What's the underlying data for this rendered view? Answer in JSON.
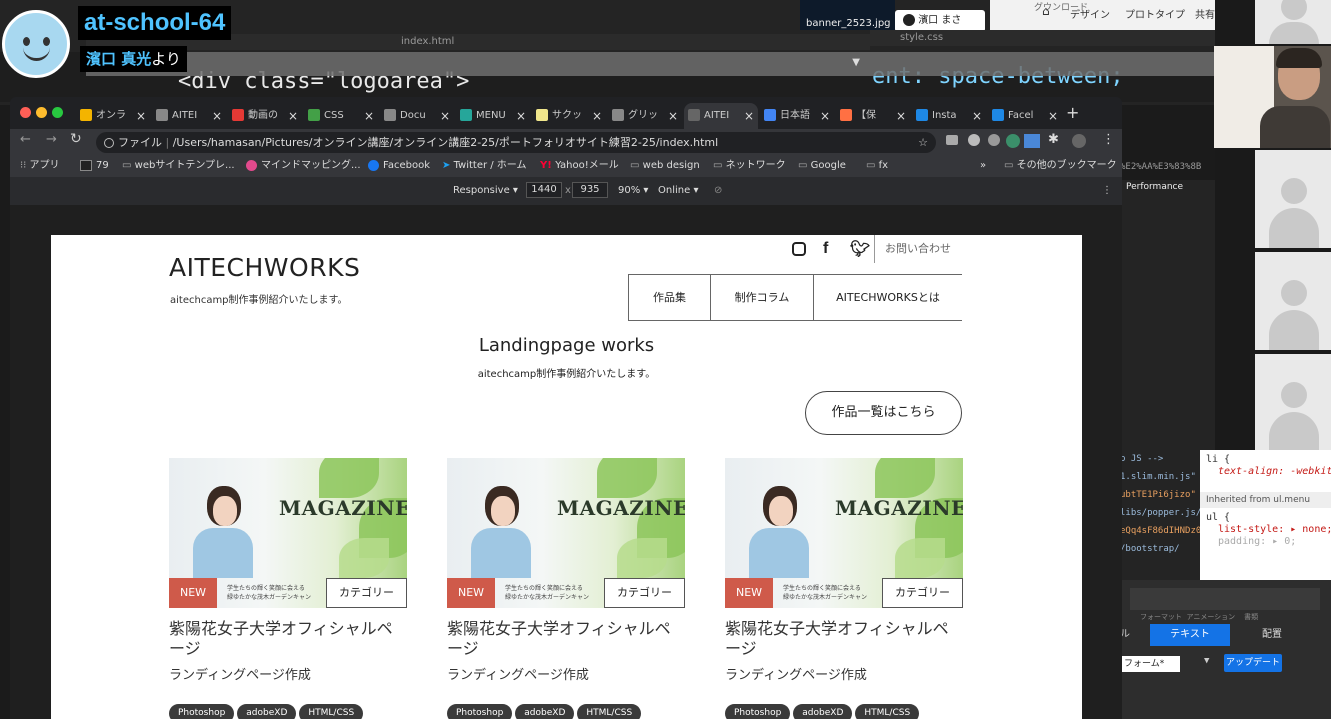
{
  "overlay": {
    "title": "at-school-64",
    "sub_name": "濱口 真光",
    "sub_suffix": "より"
  },
  "editor": {
    "tab_left": "index.html",
    "tab_right": "style.css",
    "code_left": "<div class=\"logoarea\">",
    "code_right": "ent: space-between;",
    "top_file": "banner_2523.jpg",
    "top_user": "濱口 まさ",
    "top_tab_design": "デザイン",
    "top_tab_proto": "プロトタイプ",
    "top_tab_share": "共有",
    "top_tab_download": "グウンロード"
  },
  "browser": {
    "tabs": [
      {
        "label": "オンラ",
        "color": "#f4b400"
      },
      {
        "label": "AITEI",
        "color": "#888888"
      },
      {
        "label": "動画の",
        "color": "#e53935"
      },
      {
        "label": "CSS",
        "color": "#43a047"
      },
      {
        "label": "Docu",
        "color": "#888888"
      },
      {
        "label": "MENU",
        "color": "#26a69a"
      },
      {
        "label": "サクッ",
        "color": "#f0e68c"
      },
      {
        "label": "グリッ",
        "color": "#888888"
      },
      {
        "label": "AITEI",
        "color": "#666666"
      },
      {
        "label": "日本語",
        "color": "#4285f4"
      },
      {
        "label": "【保",
        "color": "#ff7043"
      },
      {
        "label": "Insta",
        "color": "#1e88e5"
      },
      {
        "label": "Facel",
        "color": "#1e88e5"
      }
    ],
    "new_tab": "+",
    "url_prefix": "ファイル",
    "url": "/Users/hamasan/Pictures/オンライン講座/オンライン講座2-25/ポートフォリオサイト練習2-25/index.html",
    "bookmarks": [
      {
        "label": "アプリ"
      },
      {
        "label": "79"
      },
      {
        "label": "webサイトテンプレ..."
      },
      {
        "label": "マインドマッピング..."
      },
      {
        "label": "Facebook"
      },
      {
        "label": "Twitter / ホーム"
      },
      {
        "label": "Yahoo!メール"
      },
      {
        "label": "web design"
      },
      {
        "label": "ネットワーク"
      },
      {
        "label": "Google"
      },
      {
        "label": "fx"
      }
    ],
    "bookmarks_more": "»",
    "bookmarks_other": "その他のブックマーク",
    "device": "Responsive",
    "width": "1440",
    "height": "935",
    "zoom": "90%",
    "network": "Online"
  },
  "page": {
    "logo": "AITECHWORKS",
    "logo_sub": "aitechcamp制作事例紹介いたします。",
    "contact": "お問い合わせ",
    "nav": [
      "作品集",
      "制作コラム",
      "AITECHWORKSとは"
    ],
    "heading": "Landingpage works",
    "heading_sub": "aitechcamp制作事例紹介いたします。",
    "all_button": "作品一覧はこちら",
    "cards": [
      {
        "badge": "NEW",
        "category": "カテゴリー",
        "thumb_title": "MAGAZINE",
        "banner_text": "学生たちの輝く笑顔に会える\n緑ゆたかな茂木ガーデンキャン",
        "title": "紫陽花女子大学オフィシャルページ",
        "subtitle": "ランディングページ作成",
        "tags": [
          "Photoshop",
          "adobeXD",
          "HTML/CSS"
        ]
      },
      {
        "badge": "NEW",
        "category": "カテゴリー",
        "thumb_title": "MAGAZINE",
        "banner_text": "学生たちの輝く笑顔に会える\n緑ゆたかな茂木ガーデンキャン",
        "title": "紫陽花女子大学オフィシャルページ",
        "subtitle": "ランディングページ作成",
        "tags": [
          "Photoshop",
          "adobeXD",
          "HTML/CSS"
        ]
      },
      {
        "badge": "NEW",
        "category": "カテゴリー",
        "thumb_title": "MAGAZINE",
        "banner_text": "学生たちの輝く笑顔に会える\n緑ゆたかな茂木ガーデンキャン",
        "title": "紫陽花女子大学オフィシャルページ",
        "subtitle": "ランディングページ作成",
        "tags": [
          "Photoshop",
          "adobeXD",
          "HTML/CSS"
        ]
      }
    ]
  },
  "devtools": {
    "tab_performance": "Performance",
    "inherited": "Inherited from ul.menu",
    "rule1_selector": "li {",
    "rule1_prop": "text-align: -webkit-m",
    "rule2_selector": "ul {",
    "rule2_prop1": "list-style: ▸ none;",
    "rule2_prop2": "padding: ▸ 0;",
    "script_lines": [
      "p JS -->",
      "1.slim.min.js\"",
      "ubtTE1Pi6jizo\"",
      "libs/popper.js/",
      "eQq4sF86dIHNDz0",
      "/bootstrap/"
    ],
    "url_frag": "%E2%AA%E3%83%8B",
    "xd_tabs": [
      "テキスト",
      "配置"
    ],
    "xd_labels": [
      "フォーマット",
      "アニメーション",
      "書類"
    ],
    "xd_form": "フォーム*",
    "xd_update": "アップデート",
    "xd_left": "ル"
  }
}
